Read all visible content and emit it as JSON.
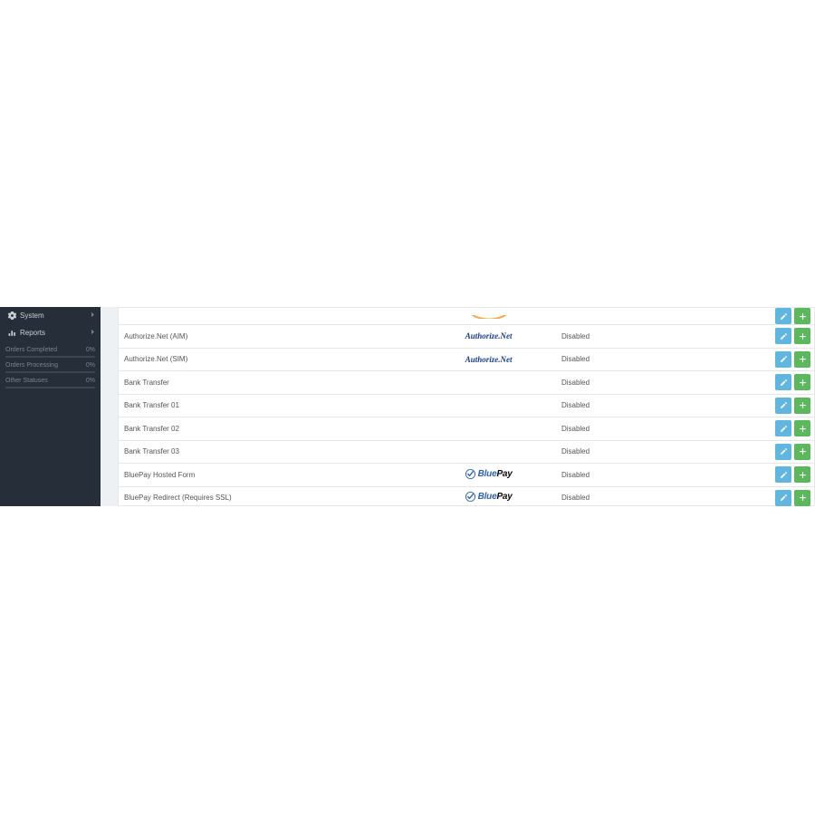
{
  "sidebar": {
    "nav": [
      {
        "label": "System",
        "icon": "gear"
      },
      {
        "label": "Reports",
        "icon": "barchart"
      }
    ],
    "stats": [
      {
        "label": "Orders Completed",
        "value": "0%"
      },
      {
        "label": "Orders Processing",
        "value": "0%"
      },
      {
        "label": "Other Statuses",
        "value": "0%"
      }
    ]
  },
  "status_text": "Disabled",
  "rows": [
    {
      "name": "",
      "logo": "amazon",
      "status": "",
      "cut": true
    },
    {
      "name": "Authorize.Net (AIM)",
      "logo": "authnet",
      "status": "Disabled"
    },
    {
      "name": "Authorize.Net (SIM)",
      "logo": "authnet",
      "status": "Disabled"
    },
    {
      "name": "Bank Transfer",
      "logo": "",
      "status": "Disabled"
    },
    {
      "name": "Bank Transfer 01",
      "logo": "",
      "status": "Disabled"
    },
    {
      "name": "Bank Transfer 02",
      "logo": "",
      "status": "Disabled"
    },
    {
      "name": "Bank Transfer 03",
      "logo": "",
      "status": "Disabled"
    },
    {
      "name": "BluePay Hosted Form",
      "logo": "bluepay",
      "status": "Disabled"
    },
    {
      "name": "BluePay Redirect (Requires SSL)",
      "logo": "bluepay",
      "status": "Disabled"
    },
    {
      "name": "",
      "logo": "",
      "status": "",
      "cut": true,
      "tail": true
    }
  ],
  "logo_labels": {
    "authnet": "Authorize.Net",
    "bluepay_blue": "Blue",
    "bluepay_pay": "Pay"
  },
  "colors": {
    "sidebar_bg": "#252e39",
    "edit_btn": "#60b6df",
    "install_btn": "#5cb85c",
    "authnet": "#1a3e8a",
    "bluepay": "#2d62a8"
  }
}
